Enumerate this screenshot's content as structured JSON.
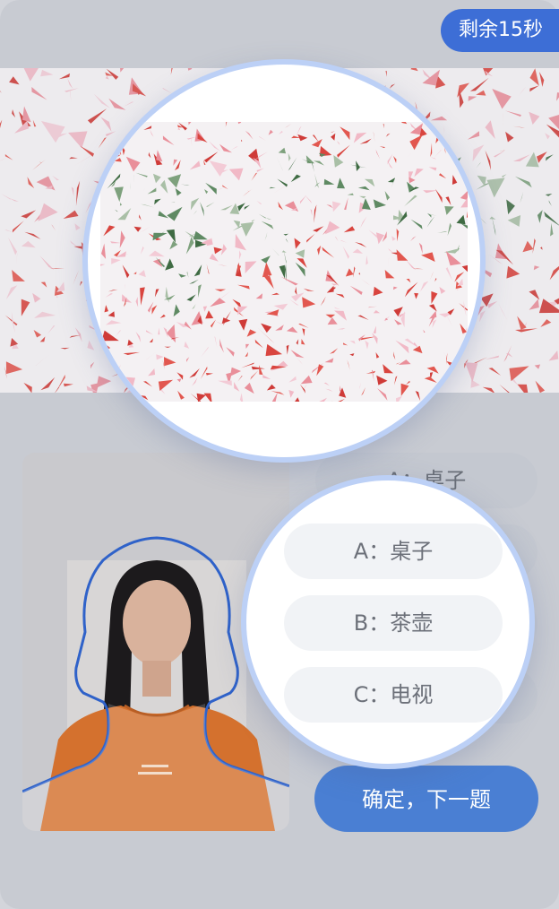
{
  "timer": {
    "label": "剩余15秒"
  },
  "question": {
    "options": [
      {
        "label": "A：桌子"
      },
      {
        "label": "B：茶壶"
      },
      {
        "label": "C：电视"
      }
    ],
    "confirm_label": "确定，下一题"
  },
  "background_options": [
    {
      "label": "A：桌子"
    },
    {
      "label": ""
    },
    {
      "label": ""
    }
  ],
  "colors": {
    "accent": "#3d6ed6",
    "confirm": "#4a7fd3",
    "magnifier_border": "#bcd0f6",
    "plate_red": "#d9453f",
    "plate_green": "#3f6b43",
    "plate_pink": "#f2c8d4"
  }
}
